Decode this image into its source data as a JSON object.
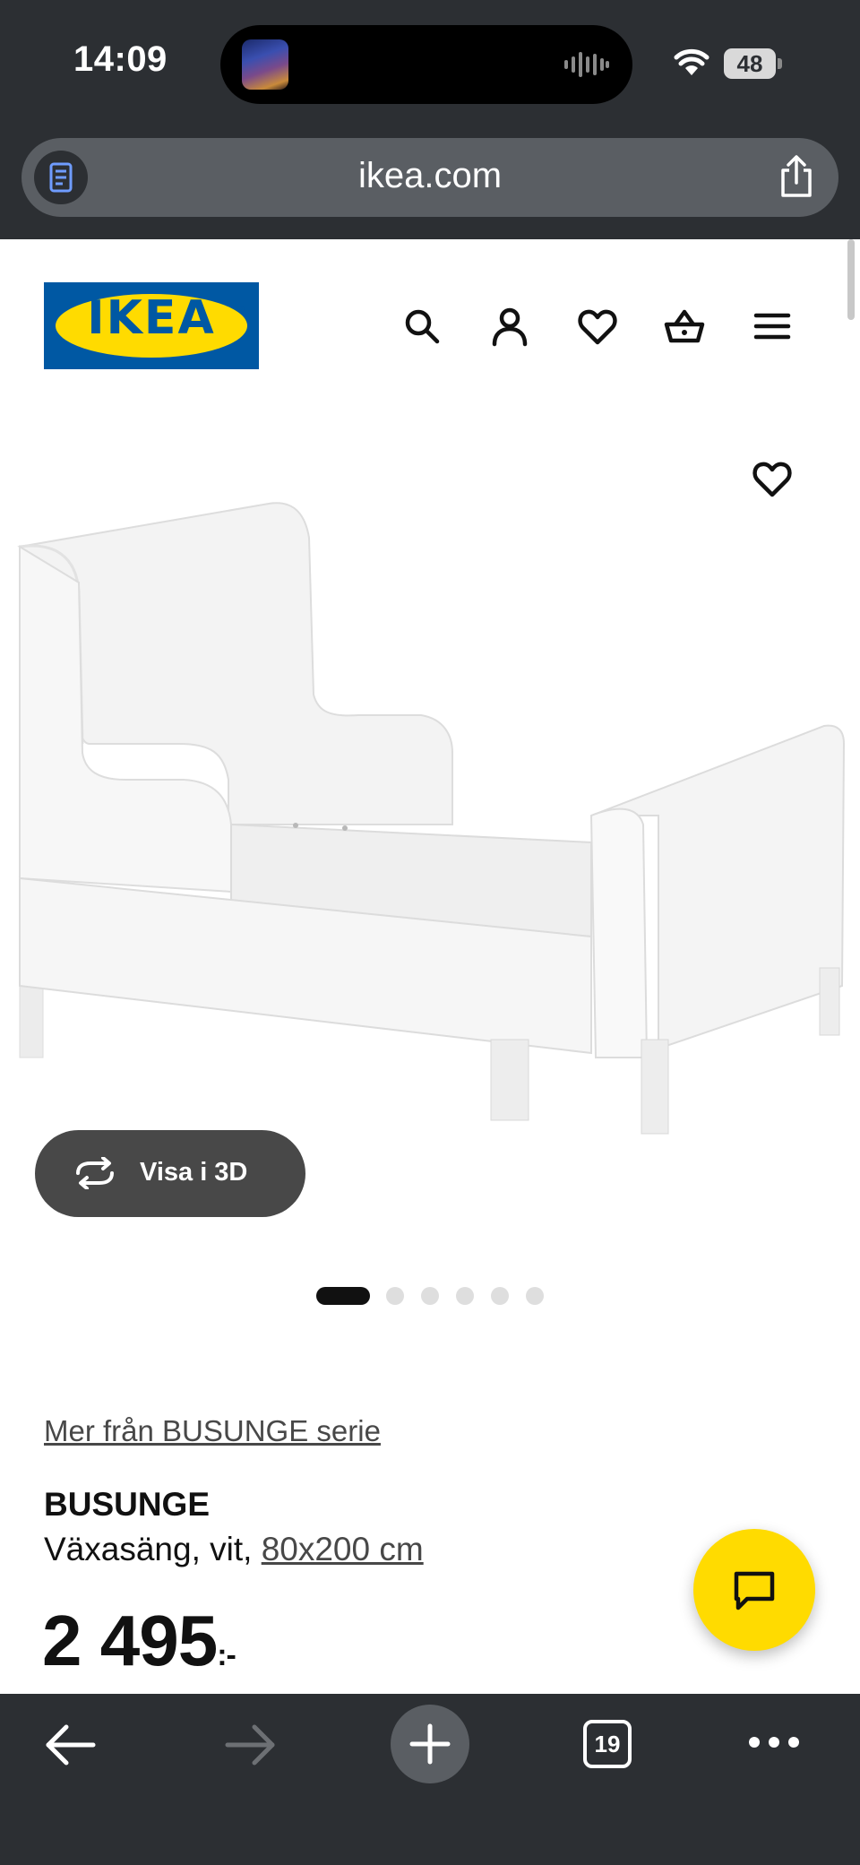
{
  "status_bar": {
    "time": "14:09",
    "battery": "48"
  },
  "browser": {
    "url": "ikea.com",
    "tab_count": "19"
  },
  "header": {
    "logo_text": "IKEA",
    "logo_registered": "®",
    "nav_icons": [
      "search-icon",
      "account-icon",
      "heart-icon",
      "basket-icon",
      "menu-icon"
    ]
  },
  "gallery": {
    "view_3d_label": "Visa i 3D",
    "image_count": 6,
    "active_image": 1
  },
  "product": {
    "series_link": "Mer från BUSUNGE serie",
    "name": "BUSUNGE",
    "desc_prefix": "Växasäng, vit, ",
    "size": "80x200 cm",
    "price": "2 495",
    "price_suffix": ":-"
  },
  "colors": {
    "ikea_blue": "#0058a3",
    "ikea_yellow": "#ffdb00",
    "chrome_dark": "#2c2f33",
    "button_dark": "#484848"
  }
}
